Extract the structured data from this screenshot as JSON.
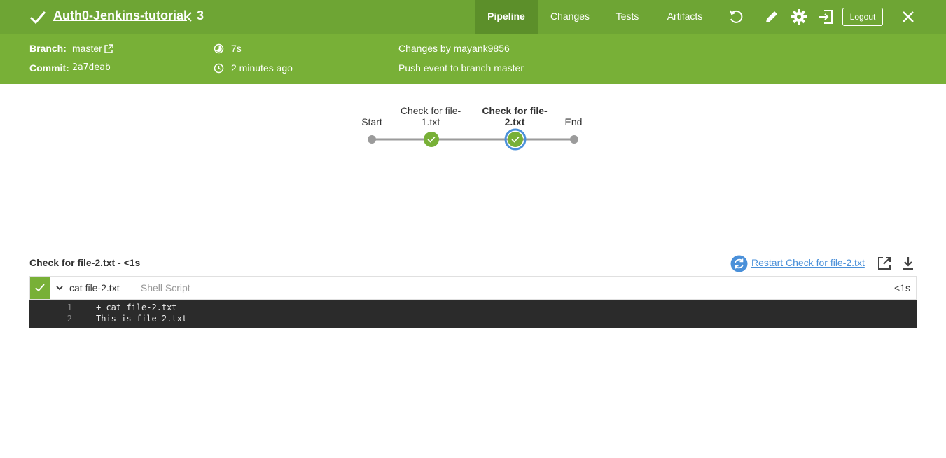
{
  "header": {
    "run_title": "Auth0-Jenkins-tutorial",
    "run_number": "3",
    "tabs": [
      {
        "label": "Pipeline",
        "active": true
      },
      {
        "label": "Changes",
        "active": false
      },
      {
        "label": "Tests",
        "active": false
      },
      {
        "label": "Artifacts",
        "active": false
      }
    ],
    "icons": [
      "replay-icon",
      "edit-icon",
      "gear-icon",
      "exit-icon",
      "close-icon"
    ],
    "logout_label": "Logout"
  },
  "details": {
    "branch_label": "Branch:",
    "branch": "master",
    "commit_label": "Commit:",
    "commit": "2a7deab",
    "duration": "7s",
    "time_ago": "2 minutes ago",
    "changes_by": "Changes by mayank9856",
    "cause": "Push event to branch master"
  },
  "pipeline": {
    "stages": [
      {
        "label": "Start",
        "status": "none",
        "selected": false
      },
      {
        "label": "Check for file-1.txt",
        "status": "success",
        "selected": false
      },
      {
        "label": "Check for file-2.txt",
        "status": "success",
        "selected": true
      },
      {
        "label": "End",
        "status": "none",
        "selected": false
      }
    ]
  },
  "step": {
    "title": "Check for file-2.txt - <1s",
    "restart_label": "Restart Check for file-2.txt",
    "name": "cat file-2.txt",
    "type": "— Shell Script",
    "duration": "<1s",
    "log": [
      {
        "num": "1",
        "text": "+ cat file-2.txt"
      },
      {
        "num": "2",
        "text": "This is file-2.txt"
      }
    ]
  },
  "colors": {
    "header_bg": "#6ea534",
    "subheader_bg": "#78b037",
    "success": "#78b037",
    "selected_ring": "#4a90d9",
    "log_bg": "#2b2b2b"
  }
}
